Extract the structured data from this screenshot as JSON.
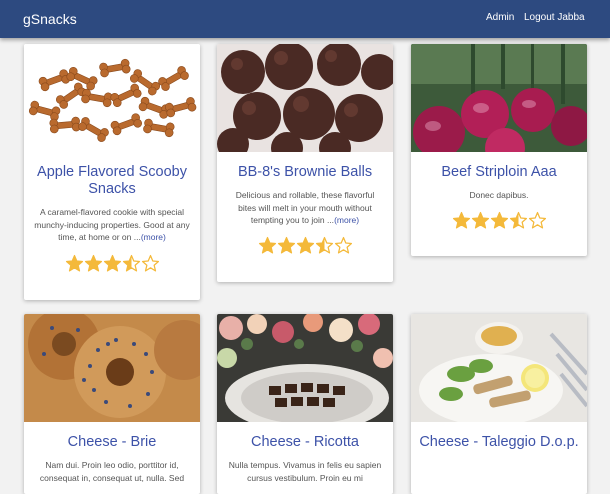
{
  "nav": {
    "brand": "gSnacks",
    "admin": "Admin",
    "logout": "Logout Jabba"
  },
  "colors": {
    "navbar": "#2d4a80",
    "accent": "#3d52a8",
    "star": "#f4b93a"
  },
  "snacks": [
    {
      "title": "Apple Flavored Scooby Snacks",
      "description": "A caramel-flavored cookie with special munchy-inducing properties. Good at any time, at home or on ...",
      "more": "(more)",
      "rating": 3.5,
      "image": "dog-biscuits"
    },
    {
      "title": "BB-8's Brownie Balls",
      "description": "Delicious and rollable, these flavorful bites will melt in your mouth without tempting you to join ...",
      "more": "(more)",
      "rating": 3.5,
      "image": "brownie-balls"
    },
    {
      "title": "Beef Striploin Aaa",
      "description": "Donec dapibus.",
      "more": "",
      "rating": 3.5,
      "image": "red-onions"
    },
    {
      "title": "Cheese - Brie",
      "description": "Nam dui. Proin leo odio, porttitor id, consequat in, consequat ut, nulla. Sed",
      "more": "",
      "rating": null,
      "image": "bagels"
    },
    {
      "title": "Cheese - Ricotta",
      "description": "Nulla tempus. Vivamus in felis eu sapien cursus vestibulum. Proin eu mi",
      "more": "",
      "rating": null,
      "image": "chocolates-flowers"
    },
    {
      "title": "Cheese - Taleggio D.o.p.",
      "description": "",
      "more": "",
      "rating": null,
      "image": "salad-plate"
    }
  ]
}
